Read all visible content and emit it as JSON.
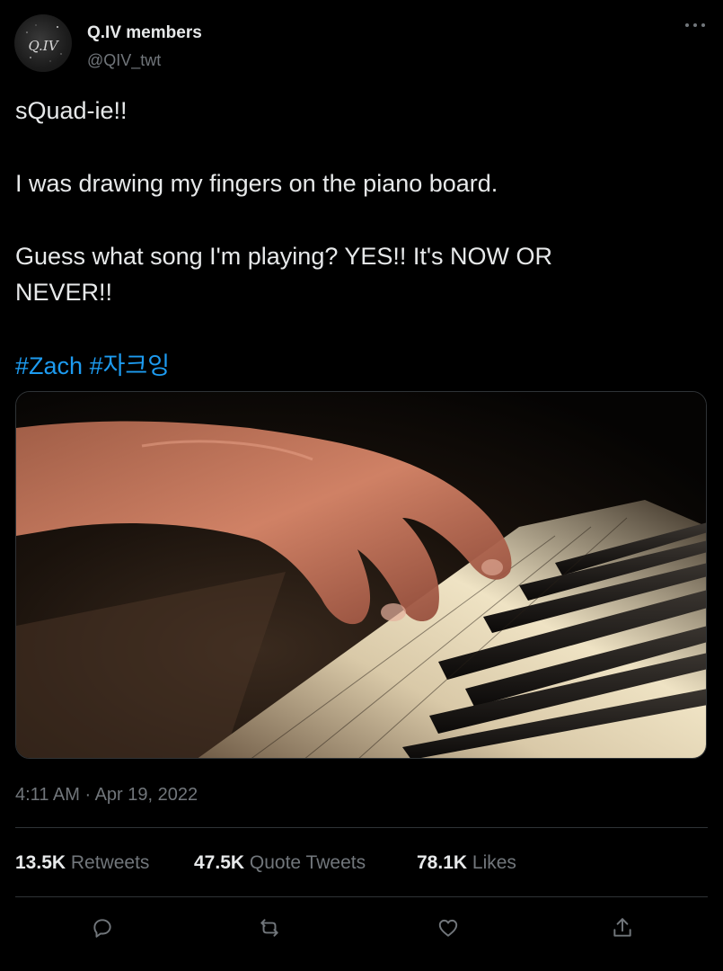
{
  "user": {
    "display_name": "Q.IV members",
    "handle": "@QIV_twt",
    "avatar_text": "Q.IV"
  },
  "tweet": {
    "line1": "sQuad-ie!!",
    "line2": "I was drawing my fingers on the piano board.",
    "line3": "Guess what song I'm playing? YES!! It's NOW OR NEVER!!",
    "hashtags": [
      "#Zach",
      "#자크잉"
    ],
    "timestamp": "4:11 AM · Apr 19, 2022"
  },
  "media": {
    "description": "hand-playing-piano-photo"
  },
  "stats": {
    "retweets_count": "13.5K",
    "retweets_label": "Retweets",
    "quotes_count": "47.5K",
    "quotes_label": "Quote Tweets",
    "likes_count": "78.1K",
    "likes_label": "Likes"
  },
  "actions": [
    "reply-icon",
    "retweet-icon",
    "like-icon",
    "share-icon"
  ],
  "colors": {
    "background": "#000000",
    "text": "#e7e9ea",
    "secondary": "#71767b",
    "link": "#1d9bf0",
    "divider": "#2f3336"
  }
}
